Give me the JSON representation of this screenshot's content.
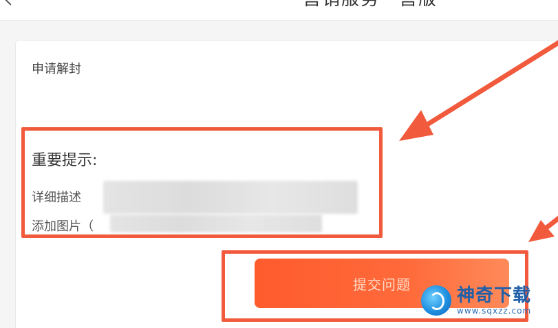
{
  "header": {
    "title": "营销服务一营版"
  },
  "card": {
    "title": "申请解封"
  },
  "notice": {
    "title": "重要提示:",
    "line1": "详细描述",
    "line2": "添加图片（"
  },
  "actions": {
    "submit_label": "提交问题"
  },
  "watermark": {
    "name": "神奇下载",
    "url": "www.sqxzz.com"
  },
  "colors": {
    "highlight": "#f15a3c",
    "button": "#ff5b2e",
    "watermark": "#1f5fa8"
  },
  "icons": {
    "back": "back-arrow-icon",
    "watermark_logo": "sqxzz-logo-icon"
  }
}
